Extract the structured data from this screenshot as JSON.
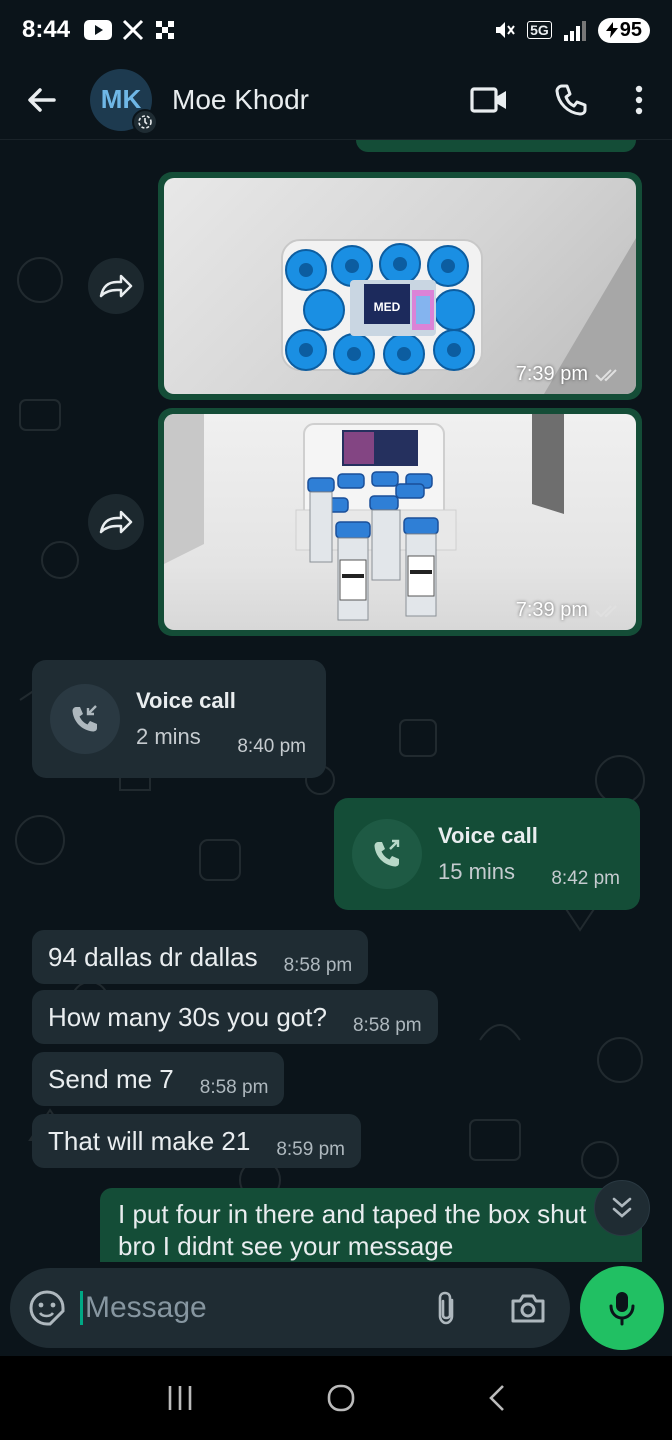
{
  "status_bar": {
    "time": "8:44",
    "network": "5G",
    "battery": "95"
  },
  "header": {
    "avatar_initials": "MK",
    "contact_name": "Moe Khodr"
  },
  "messages": {
    "image1": {
      "time": "7:39 pm",
      "label": "MED"
    },
    "image2": {
      "time": "7:39 pm"
    },
    "call_incoming": {
      "title": "Voice call",
      "duration": "2 mins",
      "time": "8:40 pm"
    },
    "call_outgoing": {
      "title": "Voice call",
      "duration": "15 mins",
      "time": "8:42 pm"
    },
    "texts": [
      {
        "text": "94 dallas dr dallas",
        "time": "8:58 pm"
      },
      {
        "text": "How many 30s you got?",
        "time": "8:58 pm"
      },
      {
        "text": "Send me 7",
        "time": "8:58 pm"
      },
      {
        "text": "That will make 21",
        "time": "8:59 pm"
      }
    ],
    "last_outgoing": {
      "text": "I put four in there and taped the box shut bro I didnt see your message"
    }
  },
  "input": {
    "placeholder": "Message"
  },
  "colors": {
    "outgoing_bubble": "#144d37",
    "incoming_bubble": "#1f2c33",
    "accent_green": "#21c063",
    "read_tick": "#8696a0"
  },
  "icons": [
    "back-arrow-icon",
    "video-call-icon",
    "phone-icon",
    "more-vert-icon",
    "forward-icon",
    "missed-call-icon",
    "outgoing-call-icon",
    "sticker-icon",
    "attach-icon",
    "camera-icon",
    "mic-icon",
    "chevron-double-down-icon"
  ]
}
